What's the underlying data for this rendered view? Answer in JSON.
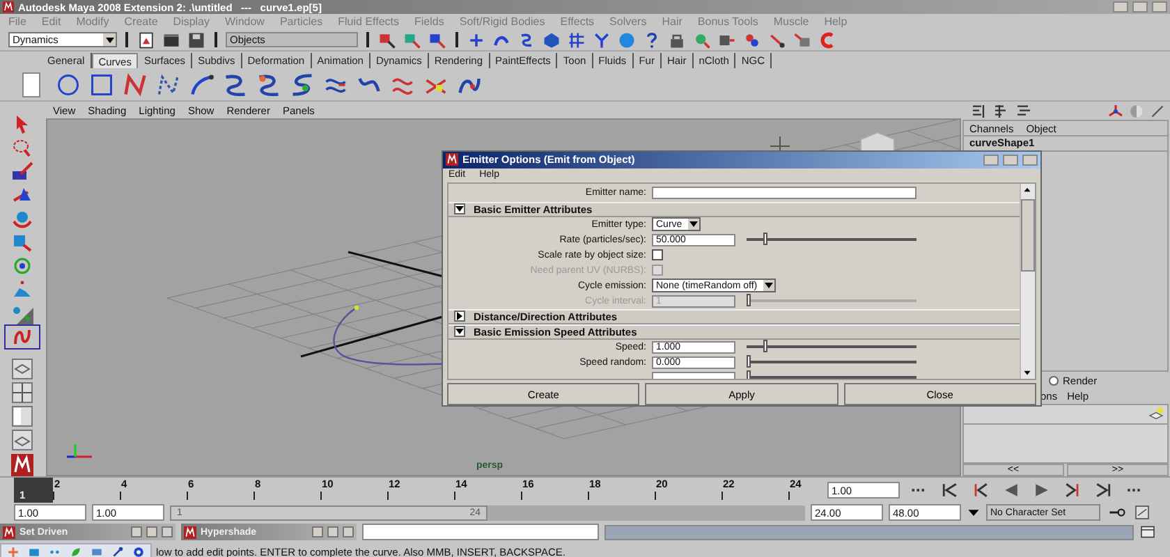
{
  "window": {
    "title": "Autodesk Maya 2008 Extension 2: .\\untitled   ---   curve1.ep[5]"
  },
  "menu_bar": [
    "File",
    "Edit",
    "Modify",
    "Create",
    "Display",
    "Window",
    "Particles",
    "Fluid Effects",
    "Fields",
    "Soft/Rigid Bodies",
    "Effects",
    "Solvers",
    "Hair",
    "Bonus Tools",
    "Muscle",
    "Help"
  ],
  "status_line": {
    "menu_set": "Dynamics",
    "selection_mode": "Objects"
  },
  "shelf_tabs": [
    {
      "label": "General",
      "selected": false
    },
    {
      "label": "Curves",
      "selected": true
    },
    {
      "label": "Surfaces",
      "selected": false
    },
    {
      "label": "Subdivs",
      "selected": false
    },
    {
      "label": "Deformation",
      "selected": false
    },
    {
      "label": "Animation",
      "selected": false
    },
    {
      "label": "Dynamics",
      "selected": false
    },
    {
      "label": "Rendering",
      "selected": false
    },
    {
      "label": "PaintEffects",
      "selected": false
    },
    {
      "label": "Toon",
      "selected": false
    },
    {
      "label": "Fluids",
      "selected": false
    },
    {
      "label": "Fur",
      "selected": false
    },
    {
      "label": "Hair",
      "selected": false
    },
    {
      "label": "nCloth",
      "selected": false
    },
    {
      "label": "NGC",
      "selected": false
    }
  ],
  "panel_menu": [
    "View",
    "Shading",
    "Lighting",
    "Show",
    "Renderer",
    "Panels"
  ],
  "viewport": {
    "camera": "persp"
  },
  "channel_box": {
    "menu": [
      "Channels",
      "Object"
    ],
    "object": "curveShape1",
    "render_option": {
      "label": "Render",
      "selected": false
    },
    "layer_menu": [
      "ons",
      "Help"
    ],
    "nav_buttons": [
      "<<",
      ">>"
    ]
  },
  "dialog": {
    "title": "Emitter Options (Emit from Object)",
    "menu": [
      "Edit",
      "Help"
    ],
    "emitter_name": {
      "label": "Emitter name:"
    },
    "sections": [
      {
        "title": "Basic Emitter Attributes",
        "expanded": true,
        "rows": [
          {
            "kind": "dropdown",
            "label": "Emitter type:",
            "value": "Curve",
            "disabled": false
          },
          {
            "kind": "slider",
            "label": "Rate (particles/sec):",
            "value": "50.000",
            "level": 0.1,
            "disabled": false
          },
          {
            "kind": "checkbox",
            "label": "Scale rate by object size:",
            "checked": false,
            "disabled": false
          },
          {
            "kind": "checkbox",
            "label": "Need parent UV (NURBS):",
            "checked": false,
            "disabled": true
          },
          {
            "kind": "dropdown",
            "label": "Cycle emission:",
            "value": "None (timeRandom off)",
            "disabled": false
          },
          {
            "kind": "slider",
            "label": "Cycle interval:",
            "value": "1",
            "level": 0,
            "disabled": true
          }
        ]
      },
      {
        "title": "Distance/Direction Attributes",
        "expanded": false
      },
      {
        "title": "Basic Emission Speed Attributes",
        "expanded": true,
        "rows": [
          {
            "kind": "slider",
            "label": "Speed:",
            "value": "1.000",
            "level": 0.1,
            "disabled": false
          },
          {
            "kind": "slider",
            "label": "Speed random:",
            "value": "0.000",
            "level": 0,
            "disabled": false
          },
          {
            "kind": "slider",
            "level": 0,
            "disabled": false
          }
        ]
      }
    ],
    "buttons": [
      "Create",
      "Apply",
      "Close"
    ]
  },
  "time_slider": {
    "current_frame": "1",
    "level": 0,
    "ticks": [
      "2",
      "4",
      "6",
      "8",
      "10",
      "12",
      "14",
      "16",
      "18",
      "20",
      "22",
      "24"
    ],
    "current_time": "1.00"
  },
  "range_slider": {
    "start_time": "1.00",
    "playback_start": "1.00",
    "range_start": "1",
    "range_end": "24",
    "level": 0.5,
    "playback_end": "24.00",
    "end_time": "48.00",
    "character_set": "No Character Set"
  },
  "taskbar": [
    {
      "title": "Set Driven"
    },
    {
      "title": "Hypershade"
    }
  ],
  "help_line": "low to add edit points. ENTER to complete the curve. Also MMB, INSERT, BACKSPACE."
}
